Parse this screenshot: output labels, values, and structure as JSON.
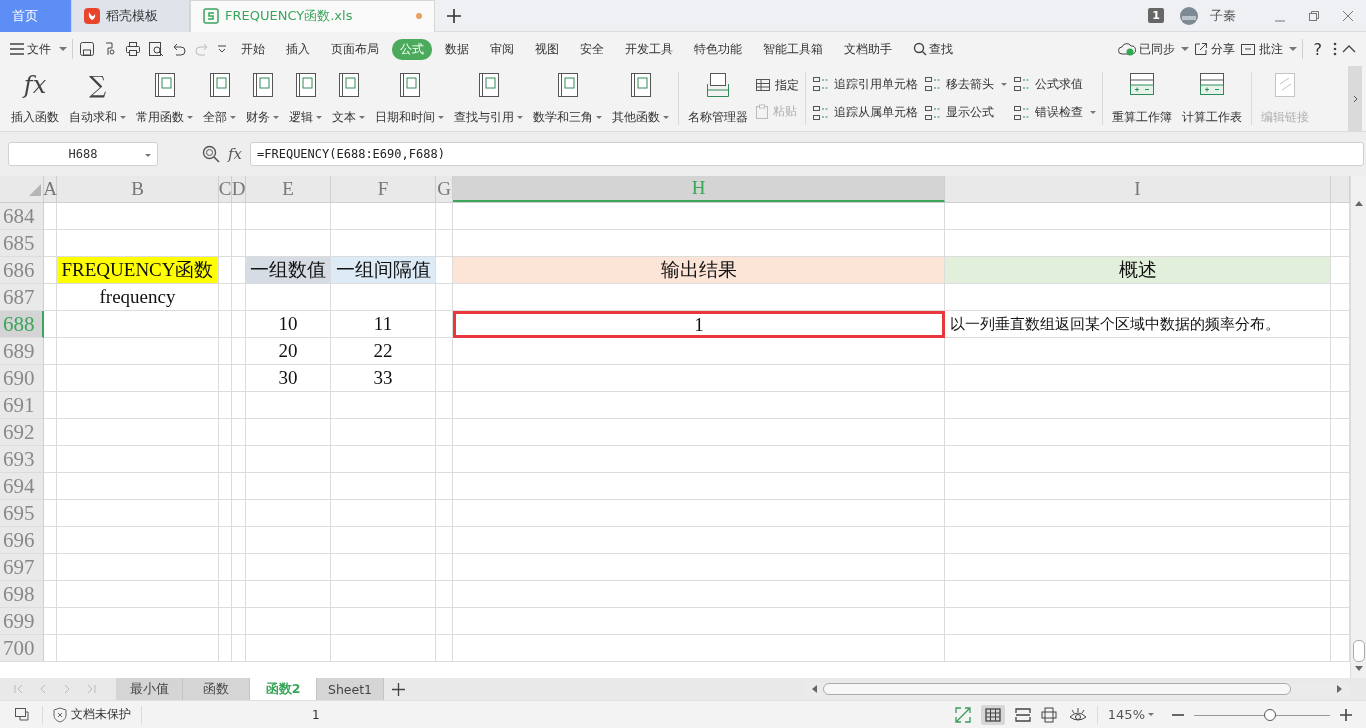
{
  "title_bar": {
    "tabs": [
      {
        "label": "首页",
        "selected": false,
        "kind": "home",
        "modified": false
      },
      {
        "label": "稻壳模板",
        "selected": false,
        "kind": "template",
        "modified": false
      },
      {
        "label": "FREQUENCY函数.xls",
        "selected": true,
        "kind": "sheet",
        "modified": true
      }
    ],
    "badge": "1",
    "user": "子秦"
  },
  "menu_bar": {
    "file": "文件",
    "tabs": [
      {
        "label": "开始",
        "selected": false
      },
      {
        "label": "插入",
        "selected": false
      },
      {
        "label": "页面布局",
        "selected": false
      },
      {
        "label": "公式",
        "selected": true
      },
      {
        "label": "数据",
        "selected": false
      },
      {
        "label": "审阅",
        "selected": false
      },
      {
        "label": "视图",
        "selected": false
      },
      {
        "label": "安全",
        "selected": false
      },
      {
        "label": "开发工具",
        "selected": false
      },
      {
        "label": "特色功能",
        "selected": false
      },
      {
        "label": "智能工具箱",
        "selected": false
      },
      {
        "label": "文档助手",
        "selected": false
      }
    ],
    "search": "查找",
    "actions": [
      {
        "label": "已同步",
        "dropdown": true
      },
      {
        "label": "分享",
        "dropdown": false
      },
      {
        "label": "批注",
        "dropdown": true
      }
    ],
    "help": "?"
  },
  "ribbon": {
    "functions": [
      {
        "label": "插入函数",
        "dropdown": false,
        "glyph": "fx"
      },
      {
        "label": "自动求和",
        "dropdown": true,
        "glyph": "∑"
      },
      {
        "label": "常用函数",
        "dropdown": true
      },
      {
        "label": "全部",
        "dropdown": true
      },
      {
        "label": "财务",
        "dropdown": true
      },
      {
        "label": "逻辑",
        "dropdown": true
      },
      {
        "label": "文本",
        "dropdown": true
      },
      {
        "label": "日期和时间",
        "dropdown": true
      },
      {
        "label": "查找与引用",
        "dropdown": true
      },
      {
        "label": "数学和三角",
        "dropdown": true
      },
      {
        "label": "其他函数",
        "dropdown": true
      }
    ],
    "name_manager": "名称管理器",
    "names": [
      {
        "label": "指定",
        "disabled": false
      },
      {
        "label": "粘贴",
        "disabled": true
      }
    ],
    "auditing": [
      {
        "label": "追踪引用单元格",
        "dropdown": false
      },
      {
        "label": "追踪从属单元格",
        "dropdown": false
      },
      {
        "label": "移去箭头",
        "dropdown": true
      },
      {
        "label": "显示公式",
        "dropdown": false
      },
      {
        "label": "公式求值",
        "dropdown": false
      },
      {
        "label": "错误检查",
        "dropdown": true
      }
    ],
    "calculation": [
      {
        "label": "重算工作簿",
        "disabled": false
      },
      {
        "label": "计算工作表",
        "disabled": false
      }
    ],
    "links": {
      "label": "编辑链接",
      "disabled": true
    }
  },
  "formula_bar": {
    "name_box": "H688",
    "fx": "fx",
    "formula": "=FREQUENCY(E688:E690,F688)"
  },
  "sheet": {
    "columns": [
      {
        "label": "A",
        "selected": false
      },
      {
        "label": "B",
        "selected": false
      },
      {
        "label": "C",
        "selected": false
      },
      {
        "label": "D",
        "selected": false
      },
      {
        "label": "E",
        "selected": false
      },
      {
        "label": "F",
        "selected": false
      },
      {
        "label": "G",
        "selected": false
      },
      {
        "label": "H",
        "selected": true
      },
      {
        "label": "I",
        "selected": false
      }
    ],
    "rows": [
      {
        "number": "684",
        "selected": false
      },
      {
        "number": "685",
        "selected": false
      },
      {
        "number": "686",
        "selected": false,
        "b": {
          "text": "FREQUENCY函数",
          "color": "#ffff00",
          "selected": false
        },
        "e": {
          "text": "一组数值",
          "color": "#d6dce4",
          "selected": false
        },
        "f": {
          "text": "一组间隔值",
          "color": "#ddebf7",
          "selected": false
        },
        "h": {
          "text": "输出结果",
          "color": "#fce4d6",
          "selected": false
        },
        "i": {
          "text": "概述",
          "color": "#e2efda",
          "selected": false
        }
      },
      {
        "number": "687",
        "selected": false,
        "b": {
          "text": "frequency",
          "selected": false
        }
      },
      {
        "number": "688",
        "selected": true,
        "e": {
          "text": "10",
          "selected": false
        },
        "f": {
          "text": "11",
          "selected": false
        },
        "h": {
          "text": "1",
          "selected": true
        },
        "i": {
          "text": "以一列垂直数组返回某个区域中数据的频率分布。",
          "kind": "note",
          "selected": false
        }
      },
      {
        "number": "689",
        "selected": false,
        "e": {
          "text": "20",
          "selected": false
        },
        "f": {
          "text": "22",
          "selected": false
        }
      },
      {
        "number": "690",
        "selected": false,
        "e": {
          "text": "30",
          "selected": false
        },
        "f": {
          "text": "33",
          "selected": false
        }
      },
      {
        "number": "691",
        "selected": false
      },
      {
        "number": "692",
        "selected": false
      },
      {
        "number": "693",
        "selected": false
      },
      {
        "number": "694",
        "selected": false
      },
      {
        "number": "695",
        "selected": false
      },
      {
        "number": "696",
        "selected": false
      },
      {
        "number": "697",
        "selected": false
      },
      {
        "number": "698",
        "selected": false
      },
      {
        "number": "699",
        "selected": false
      },
      {
        "number": "700",
        "selected": false
      }
    ]
  },
  "sheet_tabs": [
    {
      "label": "最小值",
      "selected": false
    },
    {
      "label": "函数",
      "selected": false
    },
    {
      "label": "函数2",
      "selected": true
    },
    {
      "label": "Sheet1",
      "selected": false
    }
  ],
  "status_bar": {
    "protection": "文档未保护",
    "value": "1",
    "zoom": "145%",
    "zoom_slider": {
      "level": 0.56
    }
  }
}
